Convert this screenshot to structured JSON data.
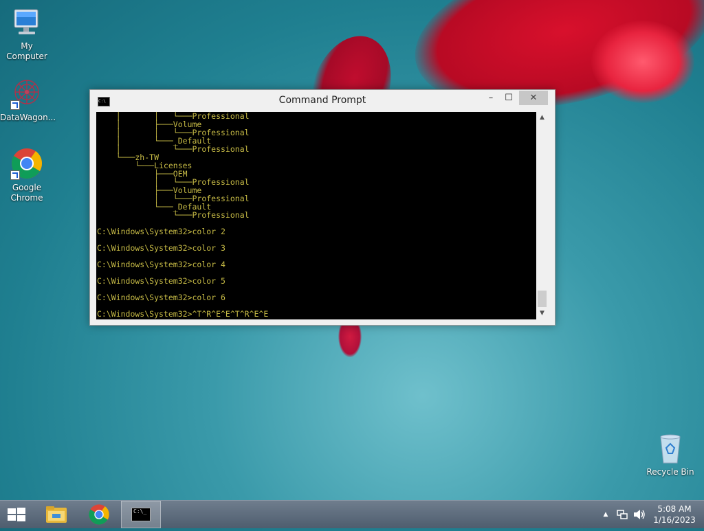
{
  "desktop": {
    "icons": [
      {
        "label": "My Computer",
        "icon": "computer-icon"
      },
      {
        "label": "DataWagon...",
        "icon": "datawagon-icon"
      },
      {
        "label": "Google Chrome",
        "icon": "chrome-icon"
      },
      {
        "label": "Recycle Bin",
        "icon": "recycle-bin-icon"
      }
    ]
  },
  "window": {
    "title": "Command Prompt",
    "icon": "cmd-icon",
    "controls": {
      "minimize": "minimize-icon",
      "maximize": "maximize-icon",
      "close": "close-icon"
    }
  },
  "console": {
    "text": "    │       │   └───Professional\n    │       ├───Volume\n    │       │   └───Professional\n    │       └───_Default\n    │           └───Professional\n    └───zh-TW\n        └───Licenses\n            ├───OEM\n            │   └───Professional\n            ├───Volume\n            │   └───Professional\n            └───_Default\n                └───Professional\n\nC:\\Windows\\System32>color 2\n\nC:\\Windows\\System32>color 3\n\nC:\\Windows\\System32>color 4\n\nC:\\Windows\\System32>color 5\n\nC:\\Windows\\System32>color 6\n\nC:\\Windows\\System32>^T^R^E^E^T^R^E^E"
  },
  "taskbar": {
    "items": [
      "start-icon",
      "file-explorer-icon",
      "chrome-icon",
      "cmd-icon"
    ],
    "tray": {
      "time": "5:08 AM",
      "date": "1/16/2023"
    }
  },
  "colors": {
    "console_text": "#c8bc46",
    "console_bg": "#000000",
    "close_button": "#c7c7c7",
    "taskbar": "#5a6878"
  }
}
